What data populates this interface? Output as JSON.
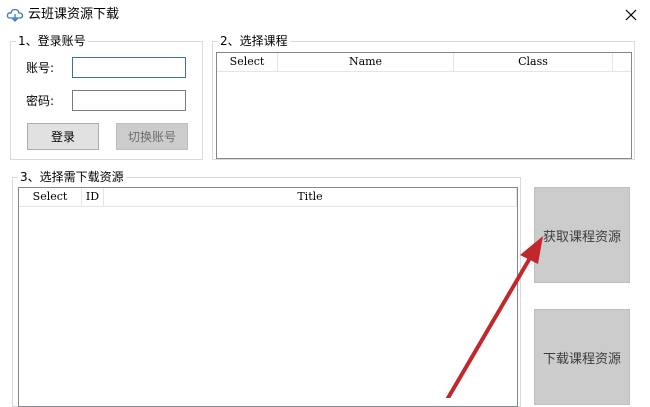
{
  "window": {
    "title": "云班课资源下载",
    "icon": "cloud-icon",
    "close_glyph": "✕"
  },
  "login_group": {
    "legend": "1、登录账号",
    "account_label": "账号:",
    "account_value": "",
    "password_label": "密码:",
    "password_value": "",
    "login_button": "登录",
    "switch_button": "切换账号"
  },
  "course_group": {
    "legend": "2、选择课程",
    "columns": [
      "Select",
      "Name",
      "Class"
    ]
  },
  "resource_group": {
    "legend": "3、选择需下载资源",
    "columns": [
      "Select",
      "ID",
      "Title"
    ]
  },
  "actions": {
    "fetch_button": "获取课程资源",
    "download_button": "下载课程资源"
  },
  "annotation": {
    "arrow_color": "#c0282b"
  }
}
